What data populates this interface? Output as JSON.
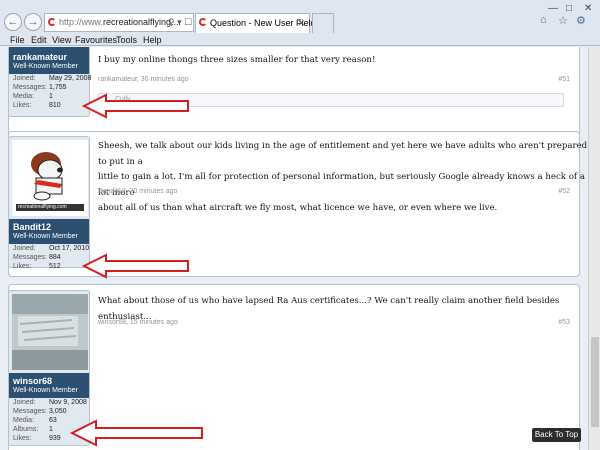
{
  "browser": {
    "address_scheme": "http://www.",
    "address_rest": "recreationalflying....",
    "tab1_title": "Question - New User Field | ...",
    "menu": [
      "File",
      "Edit",
      "View",
      "Favourites",
      "Tools",
      "Help"
    ]
  },
  "posts": [
    {
      "username": "rankamateur",
      "title": "Well-Known Member",
      "stats": [
        {
          "label": "Joined:",
          "value": "May 29, 2008"
        },
        {
          "label": "Messages:",
          "value": "1,755"
        },
        {
          "label": "Media:",
          "value": "1"
        },
        {
          "label": "Likes:",
          "value": "810"
        }
      ],
      "message": "I buy my online thongs three sizes smaller for that very reason!",
      "meta": "rankamateur, 36 minutes ago",
      "number": "#51",
      "likes_text": "Cully"
    },
    {
      "username": "Bandit12",
      "title": "Well-Known Member",
      "stats": [
        {
          "label": "Joined:",
          "value": "Oct 17, 2010"
        },
        {
          "label": "Messages:",
          "value": "884"
        },
        {
          "label": "Likes:",
          "value": "512"
        }
      ],
      "message_lines": [
        "Sheesh, we talk about our kids living in the age of entitlement and yet here we have adults who aren't prepared to put in a",
        "little to gain a lot. I'm all for protection of personal information, but seriously Google already knows a heck of a lot more",
        "about all of us than what aircraft we fly most, what licence we have, or even where we live."
      ],
      "meta": "Bandit12, 20 minutes ago",
      "number": "#52",
      "avatar_caption": "recreationalflying.com"
    },
    {
      "username": "winsor68",
      "title": "Well-Known Member",
      "stats": [
        {
          "label": "Joined:",
          "value": "Nov 9, 2008"
        },
        {
          "label": "Messages:",
          "value": "3,050"
        },
        {
          "label": "Media:",
          "value": "63"
        },
        {
          "label": "Albums:",
          "value": "1"
        },
        {
          "label": "Likes:",
          "value": "939"
        }
      ],
      "message": "What about those of us who have lapsed Ra Aus certificates...? We can't really claim another field besides enthusiast...",
      "meta": "winsor68, 15 minutes ago",
      "number": "#53"
    }
  ],
  "back_to_top": "Back To Top",
  "colors": {
    "user_header": "#2c4f72",
    "arrow": "#d42020"
  }
}
